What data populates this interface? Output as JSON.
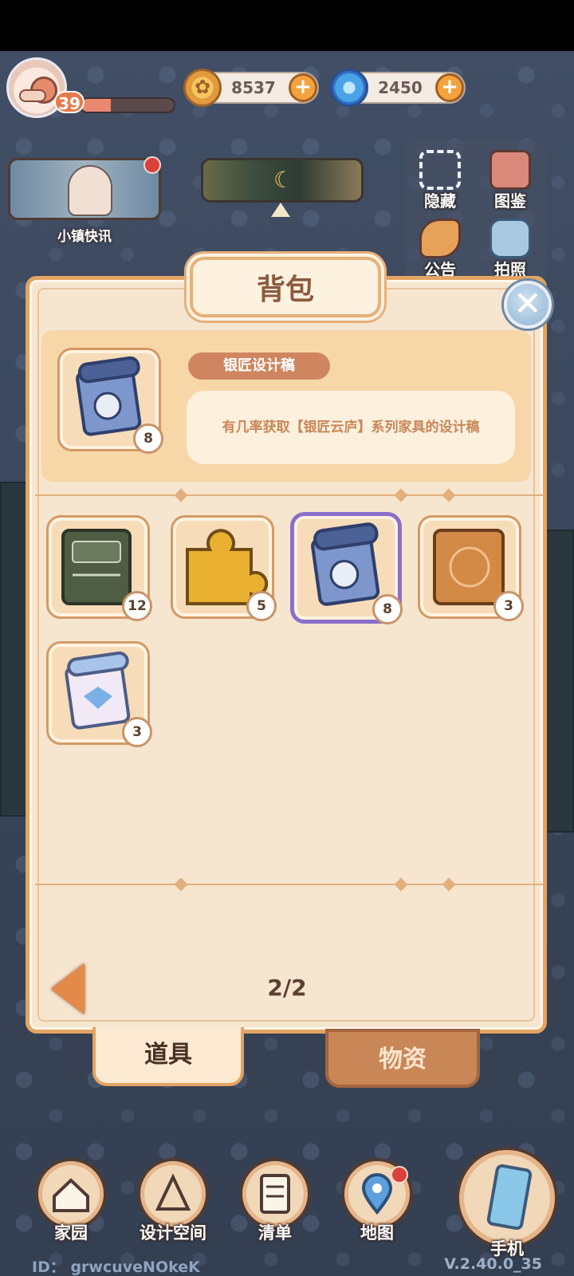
{
  "hud": {
    "level": "39",
    "xp_fraction": 0.32,
    "gold": {
      "value": "8537",
      "icon": "gold-coin-icon"
    },
    "gems": {
      "value": "2450",
      "icon": "blue-swirl-icon"
    },
    "plus": "+"
  },
  "news": {
    "label": "小镇快讯"
  },
  "side_buttons": [
    {
      "label": "隐藏",
      "icon": "hide-frame-icon"
    },
    {
      "label": "图鉴",
      "icon": "album-icon"
    },
    {
      "label": "公告",
      "icon": "announcement-icon"
    },
    {
      "label": "拍照",
      "icon": "camera-icon"
    }
  ],
  "panel": {
    "title": "背包",
    "close": "✕",
    "selected_item": {
      "name": "银匠设计稿",
      "description": "有几率获取【银匠云庐】系列家具的设计稿",
      "count": "8"
    },
    "items": [
      {
        "icon": "green-book-icon",
        "count": "12"
      },
      {
        "icon": "puzzle-piece-icon",
        "count": "5"
      },
      {
        "icon": "silver-blueprint-icon",
        "count": "8",
        "selected": true
      },
      {
        "icon": "orange-map-book-icon",
        "count": "3"
      },
      {
        "icon": "blue-blueprint-icon",
        "count": "3"
      }
    ],
    "page": "2/2",
    "tabs": [
      {
        "label": "道具",
        "active": true
      },
      {
        "label": "物资",
        "active": false
      }
    ]
  },
  "bottom_nav": [
    {
      "label": "家园",
      "icon": "home-icon"
    },
    {
      "label": "设计空间",
      "icon": "design-tools-icon"
    },
    {
      "label": "清单",
      "icon": "checklist-icon"
    },
    {
      "label": "地图",
      "icon": "map-pin-icon"
    },
    {
      "label": "手机",
      "icon": "phone-icon"
    }
  ],
  "footer": {
    "id": "ID： grwcuveNOkeK",
    "version": "V.2.40.0_35"
  },
  "colors": {
    "panel_bg": "#f6e5cf",
    "panel_border": "#e4a463",
    "selected_outline": "#8a6fc8",
    "name_pill": "#cf8660"
  }
}
